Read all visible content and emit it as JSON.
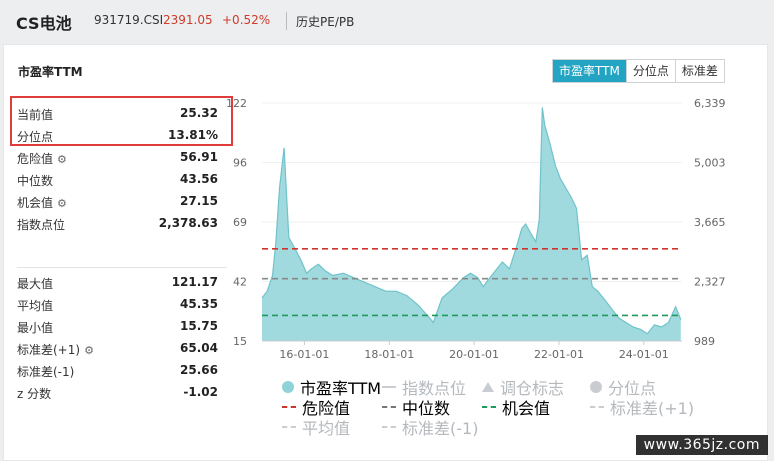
{
  "header": {
    "title": "CS电池",
    "code": "931719.CSI",
    "price": "2391.05",
    "change": "+0.52%",
    "history_label": "历史PE/PB"
  },
  "section_title": "市盈率TTM",
  "tabs": [
    {
      "label": "市盈率TTM",
      "active": true
    },
    {
      "label": "分位点",
      "active": false
    },
    {
      "label": "标准差",
      "active": false
    }
  ],
  "stats_top": [
    {
      "label": "当前值",
      "value": "25.32",
      "gear": false
    },
    {
      "label": "分位点",
      "value": "13.81%",
      "gear": false
    },
    {
      "label": "危险值",
      "value": "56.91",
      "gear": true
    },
    {
      "label": "中位数",
      "value": "43.56",
      "gear": false
    },
    {
      "label": "机会值",
      "value": "27.15",
      "gear": true
    },
    {
      "label": "指数点位",
      "value": "2,378.63",
      "gear": false
    }
  ],
  "stats_bottom": [
    {
      "label": "最大值",
      "value": "121.17",
      "gear": false
    },
    {
      "label": "平均值",
      "value": "45.35",
      "gear": false
    },
    {
      "label": "最小值",
      "value": "15.75",
      "gear": false
    },
    {
      "label": "标准差(+1)",
      "value": "65.04",
      "gear": true
    },
    {
      "label": "标准差(-1)",
      "value": "25.66",
      "gear": false
    },
    {
      "label": "z 分数",
      "value": "-1.02",
      "gear": false
    }
  ],
  "legend": [
    {
      "label": "市盈率TTM",
      "marker": "dot",
      "color": "#8fd3d8",
      "muted": false
    },
    {
      "label": "指数点位",
      "marker": "line",
      "color": "#c9ccd0",
      "muted": true
    },
    {
      "label": "调仓标志",
      "marker": "triangle",
      "color": "#c9ccd0",
      "muted": true
    },
    {
      "label": "分位点",
      "marker": "dot",
      "color": "#c9ccd0",
      "muted": true
    },
    {
      "label": "危险值",
      "marker": "dash",
      "color": "#d0342c",
      "muted": false
    },
    {
      "label": "中位数",
      "marker": "dash",
      "color": "#777777",
      "muted": false
    },
    {
      "label": "机会值",
      "marker": "dash",
      "color": "#1f9a5c",
      "muted": false
    },
    {
      "label": "标准差(+1)",
      "marker": "dash",
      "color": "#c9ccd0",
      "muted": true
    },
    {
      "label": "平均值",
      "marker": "dash",
      "color": "#c9ccd0",
      "muted": true
    },
    {
      "label": "标准差(-1)",
      "marker": "dash",
      "color": "#c9ccd0",
      "muted": true
    }
  ],
  "watermark": "www.365jz.com",
  "chart_data": {
    "type": "area",
    "left_ticks": [
      "122",
      "96",
      "69",
      "42",
      "15"
    ],
    "left_range": [
      15.75,
      122
    ],
    "right_ticks": [
      "6,339",
      "5,003",
      "3,665",
      "2,327",
      "989"
    ],
    "x_ticks": [
      "16-01-01",
      "18-01-01",
      "20-01-01",
      "22-01-01",
      "24-01-01"
    ],
    "reference_lines": {
      "danger": 56.91,
      "median": 43.56,
      "opportunity": 27.15
    },
    "grid": true,
    "series": [
      {
        "name": "市盈率TTM",
        "color": "#8fd3d8",
        "x": [
          "2015-01-01",
          "2015-02-15",
          "2015-04-01",
          "2015-05-01",
          "2015-06-01",
          "2015-07-10",
          "2015-08-20",
          "2015-10-01",
          "2015-12-01",
          "2016-01-20",
          "2016-03-01",
          "2016-05-01",
          "2016-07-01",
          "2016-09-01",
          "2016-12-01",
          "2017-03-01",
          "2017-06-01",
          "2017-09-01",
          "2017-12-01",
          "2018-03-01",
          "2018-06-01",
          "2018-09-01",
          "2018-12-15",
          "2019-01-15",
          "2019-04-01",
          "2019-07-01",
          "2019-10-01",
          "2019-12-01",
          "2020-02-01",
          "2020-03-20",
          "2020-05-01",
          "2020-07-01",
          "2020-09-01",
          "2020-11-01",
          "2021-01-01",
          "2021-02-15",
          "2021-03-20",
          "2021-05-01",
          "2021-06-15",
          "2021-07-15",
          "2021-08-10",
          "2021-09-01",
          "2021-10-15",
          "2021-12-01",
          "2022-01-15",
          "2022-03-01",
          "2022-04-15",
          "2022-06-01",
          "2022-07-15",
          "2022-09-01",
          "2022-10-15",
          "2022-12-01",
          "2023-02-01",
          "2023-04-01",
          "2023-06-01",
          "2023-08-01",
          "2023-10-01",
          "2023-12-01",
          "2024-02-01",
          "2024-04-01",
          "2024-06-01",
          "2024-08-01",
          "2024-10-01",
          "2024-11-15"
        ],
        "values": [
          35,
          38,
          45,
          60,
          84,
          102,
          62,
          58,
          52,
          46,
          48,
          50,
          47,
          45,
          46,
          44,
          42,
          40,
          38,
          38,
          36,
          32,
          26,
          24,
          35,
          39,
          44,
          46,
          44,
          40,
          43,
          47,
          51,
          48,
          58,
          66,
          68,
          64,
          60,
          70,
          120,
          112,
          104,
          94,
          88,
          84,
          80,
          75,
          52,
          54,
          40,
          38,
          34,
          30,
          26,
          24,
          22,
          21,
          19,
          23,
          22,
          24,
          31,
          25.32
        ]
      }
    ]
  }
}
